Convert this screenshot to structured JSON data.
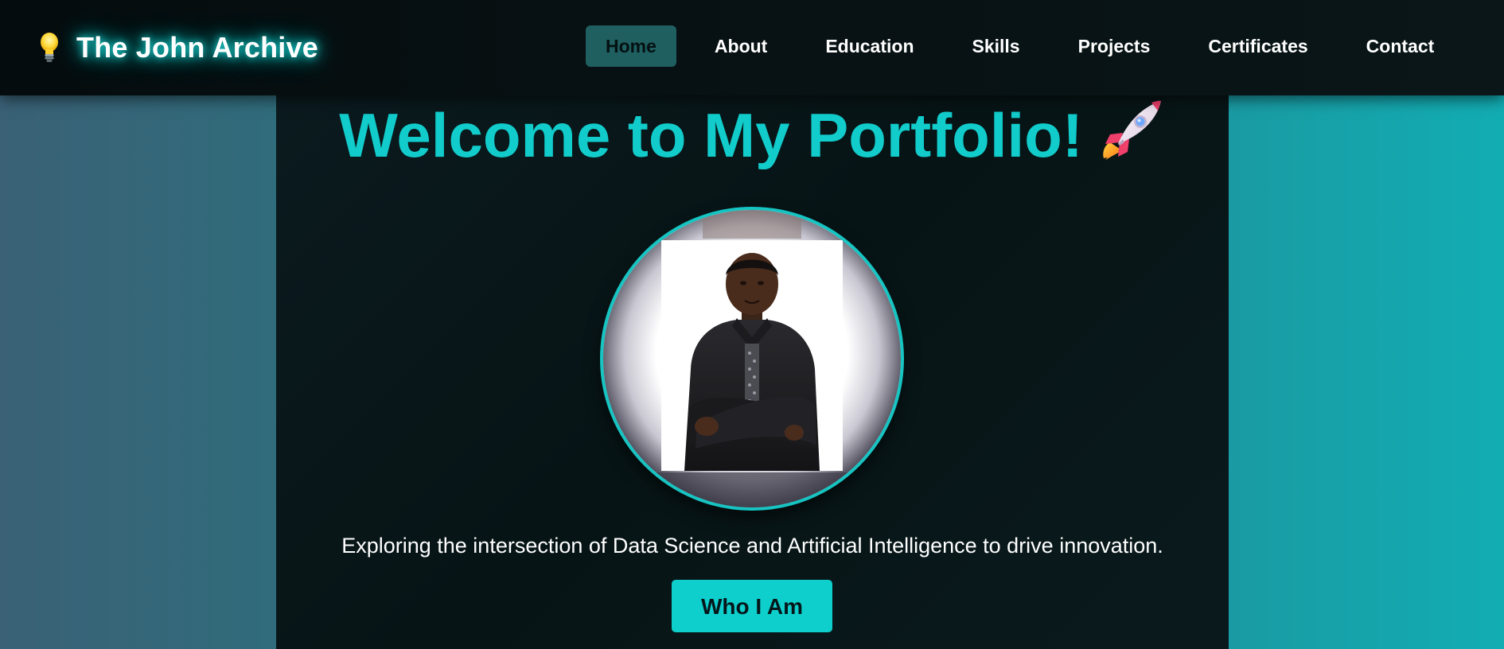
{
  "brand": {
    "icon": "lightbulb-icon",
    "title": "The John Archive"
  },
  "nav": {
    "items": [
      {
        "label": "Home",
        "active": true
      },
      {
        "label": "About",
        "active": false
      },
      {
        "label": "Education",
        "active": false
      },
      {
        "label": "Skills",
        "active": false
      },
      {
        "label": "Projects",
        "active": false
      },
      {
        "label": "Certificates",
        "active": false
      },
      {
        "label": "Contact",
        "active": false
      }
    ]
  },
  "hero": {
    "title": "Welcome to My Portfolio!",
    "title_icon": "rocket-icon",
    "avatar": "profile-photo",
    "tagline": "Exploring the intersection of Data Science and Artificial Intelligence to drive innovation.",
    "cta_label": "Who I Am"
  },
  "colors": {
    "accent": "#11cccb",
    "nav_active_bg": "#1f5f60",
    "header_bg": "#070f11",
    "panel_bg": "#071416",
    "button_bg": "#0ecfcc"
  }
}
